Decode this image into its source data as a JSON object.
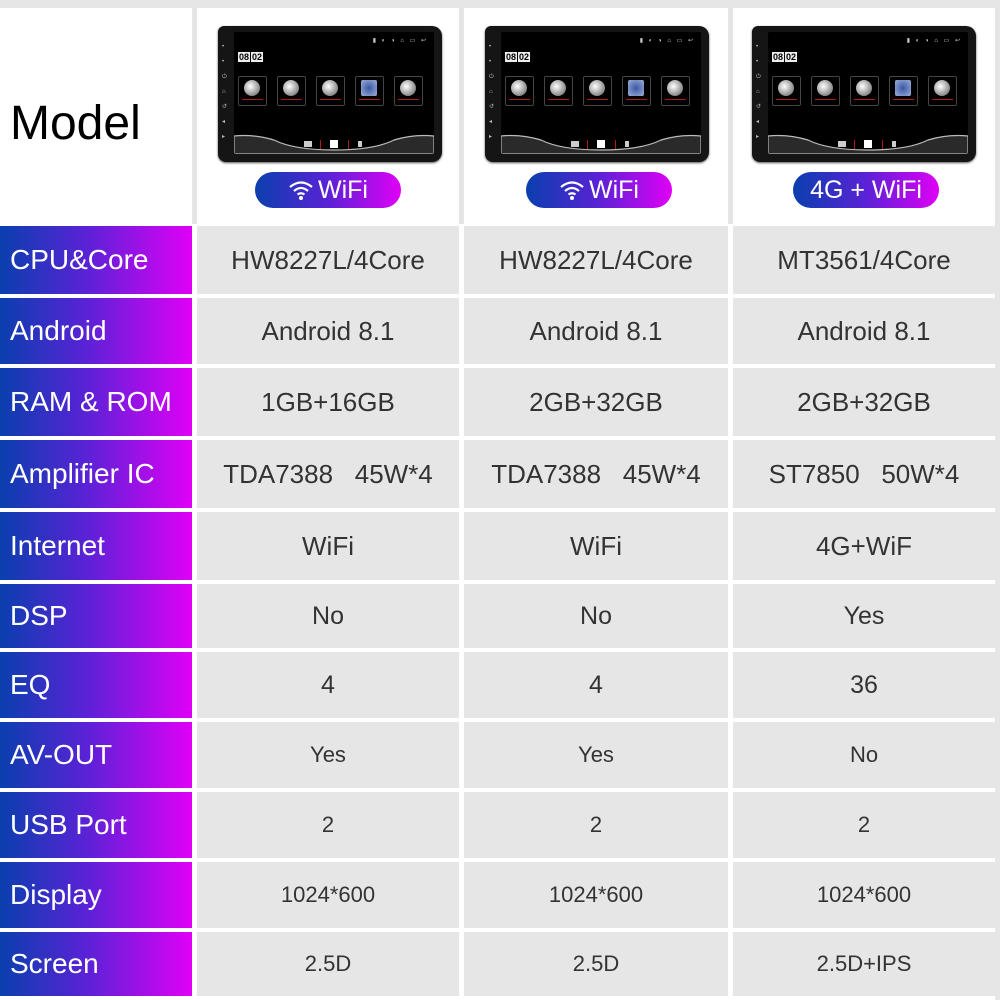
{
  "header": {
    "title": "Model",
    "models": [
      {
        "badge": "WiFi",
        "badge_icon": "wifi-icon"
      },
      {
        "badge": "WiFi",
        "badge_icon": "wifi-icon"
      },
      {
        "badge": "4G + WiFi",
        "badge_icon": null
      }
    ],
    "device_screen": {
      "clock_hours": "08",
      "clock_minutes": "02",
      "apps": [
        "Navi",
        "video",
        "BT",
        "Music",
        "Setting"
      ]
    }
  },
  "colors": {
    "gradient_start": "#0a3fae",
    "gradient_end": "#e000f6",
    "cell_background": "#e6e6e6",
    "value_text": "#333333"
  },
  "rows": [
    {
      "label": "CPU&Core",
      "values": [
        "HW8227L/4Core",
        "HW8227L/4Core",
        "MT3561/4Core"
      ]
    },
    {
      "label": "Android",
      "values": [
        "Android 8.1",
        "Android 8.1",
        "Android 8.1"
      ]
    },
    {
      "label": "RAM & ROM",
      "values": [
        "1GB+16GB",
        "2GB+32GB",
        "2GB+32GB"
      ]
    },
    {
      "label": "Amplifier IC",
      "values": [
        "TDA7388   45W*4",
        "TDA7388   45W*4",
        "ST7850   50W*4"
      ]
    },
    {
      "label": "Internet",
      "values": [
        "WiFi",
        "WiFi",
        "4G+WiF"
      ]
    },
    {
      "label": "DSP",
      "values": [
        "No",
        "No",
        "Yes"
      ]
    },
    {
      "label": "EQ",
      "values": [
        "4",
        "4",
        "36"
      ]
    },
    {
      "label": "AV-OUT",
      "values": [
        "Yes",
        "Yes",
        "No"
      ]
    },
    {
      "label": "USB Port",
      "values": [
        "2",
        "2",
        "2"
      ]
    },
    {
      "label": "Display",
      "values": [
        "1024*600",
        "1024*600",
        "1024*600"
      ]
    },
    {
      "label": "Screen",
      "values": [
        "2.5D",
        "2.5D",
        "2.5D+IPS"
      ]
    }
  ]
}
